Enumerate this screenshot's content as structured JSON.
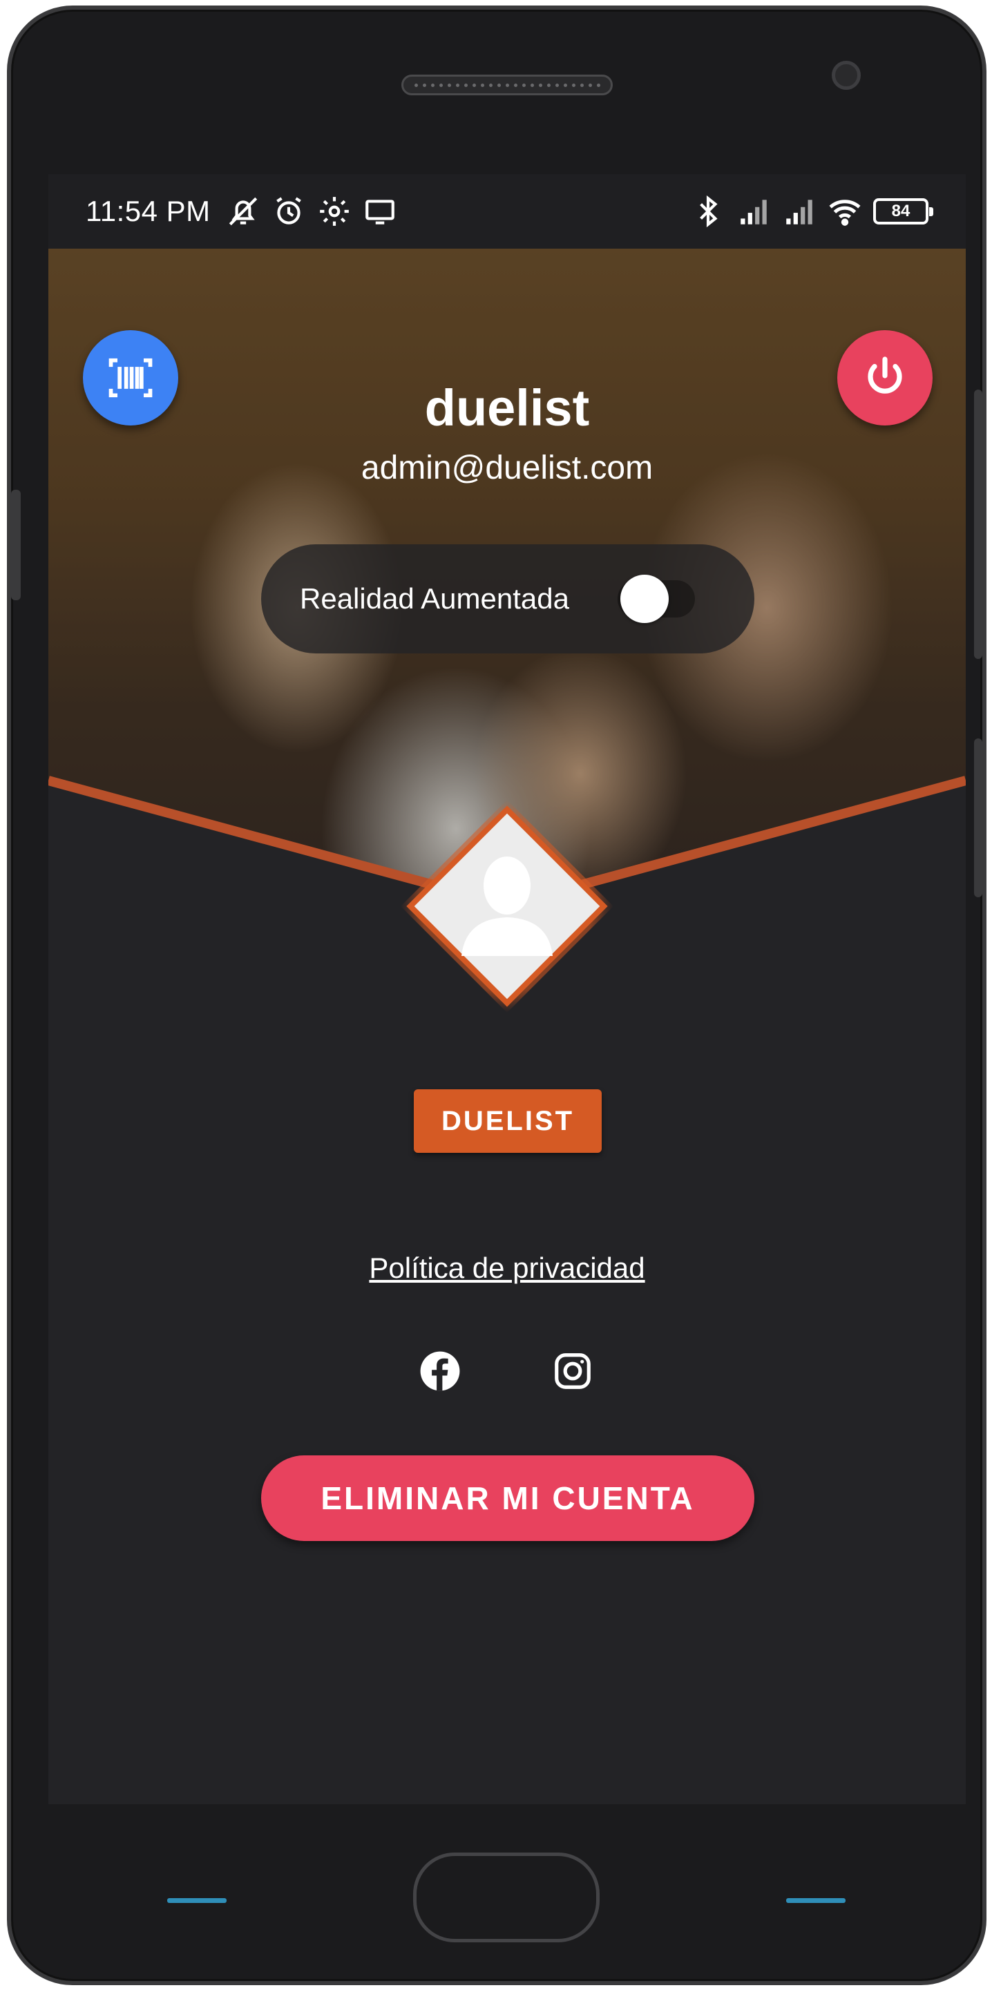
{
  "status_bar": {
    "time": "11:54 PM",
    "battery_level": "84",
    "icons_left": [
      "notifications-off-icon",
      "alarm-icon",
      "settings-gear-icon",
      "screen-cast-icon"
    ],
    "icons_right": [
      "bluetooth-icon",
      "signal-icon",
      "signal-icon",
      "wifi-icon",
      "battery-icon"
    ]
  },
  "profile": {
    "username": "duelist",
    "email": "admin@duelist.com",
    "ar_toggle_label": "Realidad Aumentada",
    "ar_toggle_on": false,
    "role_badge": "DUELIST"
  },
  "links": {
    "privacy_policy": "Política de privacidad"
  },
  "social": [
    "facebook-icon",
    "instagram-icon"
  ],
  "actions": {
    "delete_account": "ELIMINAR MI CUENTA"
  },
  "colors": {
    "background": "#232326",
    "accent_blue": "#3d82f4",
    "accent_red": "#e8425e",
    "accent_orange": "#d55a24"
  }
}
